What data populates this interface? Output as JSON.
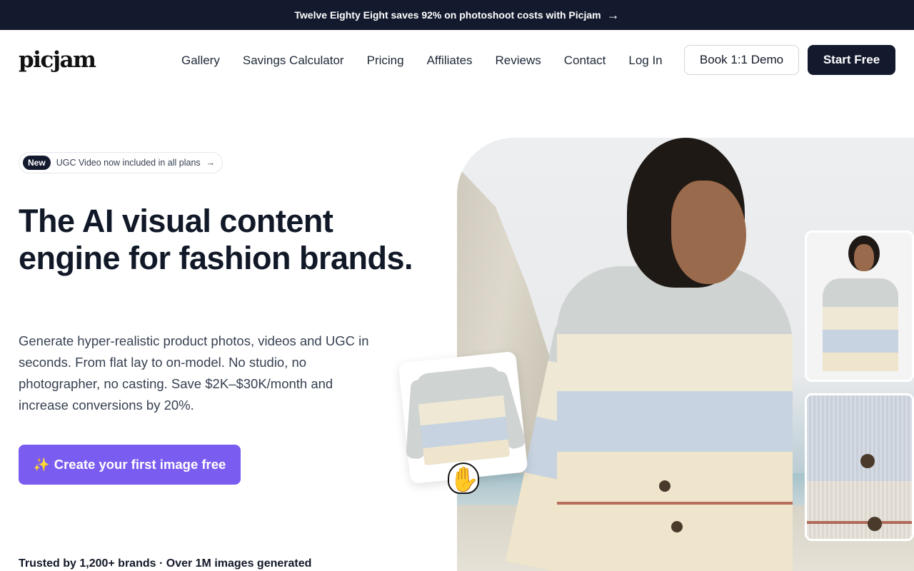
{
  "announcement": {
    "text": "Twelve Eighty Eight saves 92% on photoshoot costs with Picjam",
    "arrow": "→"
  },
  "header": {
    "logo": "picjam",
    "nav": [
      {
        "label": "Gallery"
      },
      {
        "label": "Savings Calculator"
      },
      {
        "label": "Pricing"
      },
      {
        "label": "Affiliates"
      },
      {
        "label": "Reviews"
      },
      {
        "label": "Contact"
      },
      {
        "label": "Log In"
      }
    ],
    "demo_button": "Book 1:1 Demo",
    "start_button": "Start Free"
  },
  "hero": {
    "pill_badge": "New",
    "pill_text": "UGC Video now included in all plans",
    "pill_arrow": "→",
    "title": "The AI visual content engine for fashion brands.",
    "subtitle": "Generate hyper-realistic product photos, videos and UGC in seconds. From flat lay to on-model. No studio, no photographer, no casting. Save $2K–$30K/month and increase conversions by 20%.",
    "cta_icon": "✨",
    "cta_label": "Create your first image free",
    "trusted": "Trusted by 1,200+ brands  · Over 1M images generated"
  },
  "icons": {
    "announce_arrow": "arrow-right-icon",
    "pill_arrow": "arrow-right-icon",
    "cta_sparkle": "sparkle-icon",
    "hand": "hand-cursor-icon"
  },
  "colors": {
    "topbar": "#131a2e",
    "cta": "#7b5cf0",
    "primary_button": "#131a2e"
  }
}
